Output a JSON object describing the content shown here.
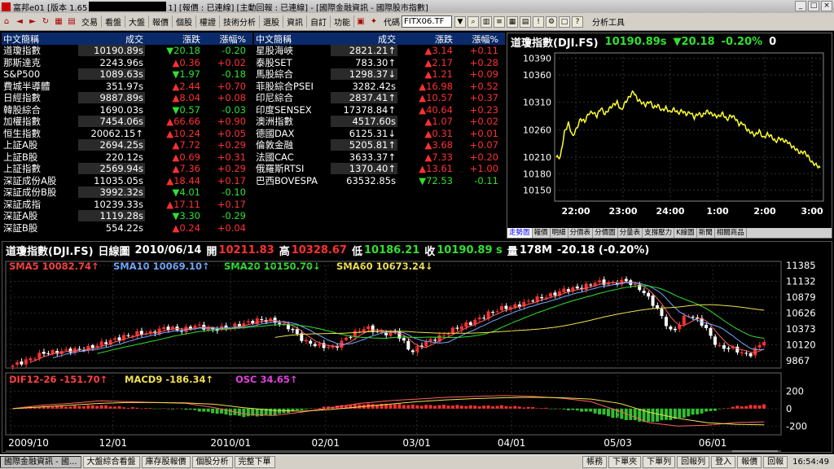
{
  "title_bar": {
    "text_pre": "富邦e01 [版本 1.65",
    "text_post": "1] [報價 : 已連線] [主動回報 : 已連線] - [國際金融資訊 - 國際股市指數]",
    "controls": [
      "_",
      "□",
      "×"
    ]
  },
  "toolbar": {
    "menus": [
      "交易",
      "看盤",
      "大盤",
      "報價",
      "個股",
      "權證",
      "技術分析",
      "選股",
      "資訊",
      "自訂",
      "功能"
    ],
    "code_label": "代碼",
    "code_value": "FITX06.TF",
    "analysis_tools": "分析工具"
  },
  "quotes": {
    "headers": {
      "name": "中文簡稱",
      "price": "成交",
      "change": "漲跌",
      "pct": "漲幅%"
    },
    "left": [
      {
        "name": "道瓊指數",
        "price": "10190.89s",
        "change": "20.18",
        "dir": "dn",
        "pct": "-0.20"
      },
      {
        "name": "那斯達克",
        "price": "2243.96s",
        "change": "0.36",
        "dir": "up",
        "pct": "+0.02"
      },
      {
        "name": "S&P500",
        "price": "1089.63s",
        "change": "1.97",
        "dir": "dn",
        "pct": "-0.18"
      },
      {
        "name": "費城半導體",
        "price": "351.97s",
        "change": "2.44",
        "dir": "up",
        "pct": "+0.70"
      },
      {
        "name": "日經指數",
        "price": "9887.89s",
        "change": "8.04",
        "dir": "up",
        "pct": "+0.08"
      },
      {
        "name": "韓股綜合",
        "price": "1690.03s",
        "change": "0.57",
        "dir": "dn",
        "pct": "-0.03"
      },
      {
        "name": "加權指數",
        "price": "7454.06s",
        "change": "66.66",
        "dir": "up",
        "pct": "+0.90"
      },
      {
        "name": "恒生指數",
        "price": "20062.15↑",
        "change": "10.24",
        "dir": "up",
        "pct": "+0.05"
      },
      {
        "name": "上証A股",
        "price": "2694.25s",
        "change": "7.72",
        "dir": "up",
        "pct": "+0.29"
      },
      {
        "name": "上証B股",
        "price": "220.12s",
        "change": "0.69",
        "dir": "up",
        "pct": "+0.31"
      },
      {
        "name": "上証指數",
        "price": "2569.94s",
        "change": "7.36",
        "dir": "up",
        "pct": "+0.29"
      },
      {
        "name": "深証成份A股",
        "price": "11035.05s",
        "change": "18.44",
        "dir": "up",
        "pct": "+0.17"
      },
      {
        "name": "深証成份B股",
        "price": "3992.32s",
        "change": "4.01",
        "dir": "dn",
        "pct": "-0.10"
      },
      {
        "name": "深証成指",
        "price": "10239.33s",
        "change": "17.11",
        "dir": "up",
        "pct": "+0.17"
      },
      {
        "name": "深証A股",
        "price": "1119.28s",
        "change": "3.30",
        "dir": "dn",
        "pct": "-0.29"
      },
      {
        "name": "深証B股",
        "price": "554.22s",
        "change": "0.24",
        "dir": "up",
        "pct": "+0.04"
      }
    ],
    "right": [
      {
        "name": "星股海峽",
        "price": "2821.21↑",
        "change": "3.14",
        "dir": "up",
        "pct": "+0.11"
      },
      {
        "name": "泰股SET",
        "price": "783.30↑",
        "change": "2.17",
        "dir": "up",
        "pct": "+0.28"
      },
      {
        "name": "馬股綜合",
        "price": "1298.37↓",
        "change": "1.21",
        "dir": "up",
        "pct": "+0.09"
      },
      {
        "name": "菲股綜合PSEI",
        "price": "3282.42s",
        "change": "16.98",
        "dir": "up",
        "pct": "+0.52"
      },
      {
        "name": "印尼綜合",
        "price": "2837.41↑",
        "change": "10.57",
        "dir": "up",
        "pct": "+0.37"
      },
      {
        "name": "印度SENSEX",
        "price": "17378.84↑",
        "change": "40.64",
        "dir": "up",
        "pct": "+0.23"
      },
      {
        "name": "澳洲指數",
        "price": "4517.60s",
        "change": "1.07",
        "dir": "up",
        "pct": "+0.02"
      },
      {
        "name": "德國DAX",
        "price": "6125.31↓",
        "change": "0.31",
        "dir": "up",
        "pct": "+0.01"
      },
      {
        "name": "倫敦金融",
        "price": "5205.81↑",
        "change": "3.68",
        "dir": "up",
        "pct": "+0.07"
      },
      {
        "name": "法國CAC",
        "price": "3633.37↑",
        "change": "7.33",
        "dir": "up",
        "pct": "+0.20"
      },
      {
        "name": "俄羅斯RTSI",
        "price": "1370.40↑",
        "change": "13.61",
        "dir": "up",
        "pct": "+1.00"
      },
      {
        "name": "巴西BOVESPA",
        "price": "63532.85s",
        "change": "72.53",
        "dir": "dn",
        "pct": "-0.11"
      }
    ]
  },
  "intraday": {
    "title": "道瓊指數(DJI.FS)",
    "price": "10190.89s",
    "change": "▼20.18",
    "pct": "-0.20%",
    "volume": "0",
    "tabs": [
      "走勢圖",
      "報價",
      "明細",
      "分價表",
      "分價圖",
      "分量表",
      "支撐壓力",
      "K線圖",
      "新聞",
      "相關商品"
    ]
  },
  "daily": {
    "title": "道瓊指數(DJI.FS)",
    "period": "日線圖",
    "date": "2010/06/14",
    "open_label": "開",
    "open": "10211.83",
    "high_label": "高",
    "high": "10328.67",
    "low_label": "低",
    "low": "10186.21",
    "close_label": "收",
    "close": "10190.89 s",
    "vol_label": "量",
    "volume": "178M",
    "chg": "-20.18 (-0.20%)",
    "sma": [
      {
        "text": "SMA5 10082.74↑",
        "color": "#ff4040"
      },
      {
        "text": "SMA10 10069.10↑",
        "color": "#6fa8ff"
      },
      {
        "text": "SMA20 10150.70↓",
        "color": "#30e030"
      },
      {
        "text": "SMA60 10673.24↓",
        "color": "#f0e050"
      }
    ],
    "macd_legend": [
      {
        "text": "DIF12-26 -151.70↑",
        "color": "#ff4040"
      },
      {
        "text": "MACD9 -186.34↑",
        "color": "#f0e050"
      },
      {
        "text": "OSC 34.65↑",
        "color": "#e040e0"
      }
    ]
  },
  "chart_data": [
    {
      "type": "line",
      "title": "道瓊指數(DJI.FS)",
      "x_ticks": [
        "22:00",
        "23:00",
        "24:00",
        "1:00",
        "2:00",
        "3:00"
      ],
      "y_ticks": [
        10390,
        10360,
        10310,
        10260,
        10210,
        10180,
        10150
      ],
      "ylim": [
        10130,
        10400
      ],
      "series": [
        {
          "values": [
            10210,
            10210,
            10255,
            10272,
            10248,
            10262,
            10280,
            10275,
            10290,
            10292,
            10285,
            10300,
            10288,
            10298,
            10305,
            10310,
            10295,
            10310,
            10320,
            10330,
            10315,
            10310,
            10305,
            10312,
            10300,
            10305,
            10295,
            10300,
            10292,
            10298,
            10290,
            10295,
            10288,
            10292,
            10282,
            10290,
            10285,
            10294,
            10290,
            10286,
            10284,
            10290,
            10278,
            10286,
            10282,
            10270,
            10272,
            10260,
            10255,
            10250,
            10258,
            10245,
            10252,
            10248,
            10238,
            10245,
            10240,
            10238,
            10230,
            10225,
            10218,
            10220,
            10212,
            10200,
            10196,
            10191
          ]
        }
      ]
    },
    {
      "type": "bar",
      "title": "道瓊指數(DJI.FS) 日線圖",
      "x_ticks": [
        "2009/10",
        "12/01",
        "2010/01",
        "02/01",
        "03/01",
        "04/01",
        "05/03",
        "06/01"
      ],
      "y_ticks": [
        11385,
        11132,
        10879,
        10626,
        10373,
        10120,
        9867
      ],
      "ylim": [
        9750,
        11450
      ],
      "macd_y_ticks": [
        200,
        0,
        -200
      ],
      "macd_ylim": [
        -300,
        260
      ],
      "close_anchors": [
        9790,
        9880,
        9990,
        10010,
        10040,
        10070,
        10160,
        10230,
        10300,
        10310,
        10400,
        10350,
        10430,
        10360,
        10400,
        10450,
        10520,
        10500,
        10400,
        10180,
        10100,
        10080,
        10270,
        10400,
        10300,
        10320,
        10000,
        10170,
        10260,
        10400,
        10480,
        10620,
        10710,
        10750,
        10850,
        10900,
        11000,
        11020,
        11120,
        11100,
        11140,
        11000,
        10700,
        10300,
        10620,
        10450,
        10080,
        10060,
        9940,
        10190
      ],
      "series": [
        {
          "name": "DIF12-26",
          "values": [
            0,
            40,
            60,
            90,
            80,
            70,
            60,
            10,
            -60,
            -80,
            -40,
            10,
            60,
            90,
            110,
            130,
            140,
            150,
            140,
            120,
            80,
            -30,
            -160,
            -200,
            -190,
            -160,
            -152
          ]
        },
        {
          "name": "MACD9",
          "values": [
            0,
            20,
            40,
            60,
            70,
            70,
            65,
            50,
            10,
            -20,
            -30,
            -10,
            20,
            50,
            80,
            100,
            115,
            125,
            130,
            125,
            110,
            60,
            -40,
            -110,
            -160,
            -180,
            -186
          ]
        },
        {
          "name": "OSC",
          "values": [
            0,
            20,
            20,
            30,
            10,
            0,
            -5,
            -40,
            -70,
            -60,
            -10,
            20,
            40,
            40,
            30,
            30,
            25,
            25,
            10,
            -5,
            -30,
            -90,
            -120,
            -90,
            -30,
            20,
            35
          ]
        }
      ]
    }
  ]
}
